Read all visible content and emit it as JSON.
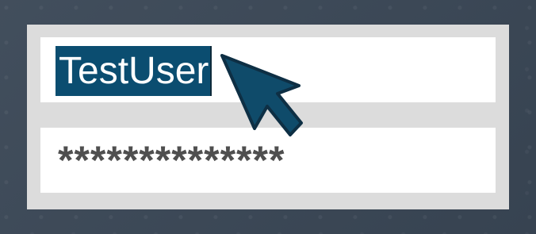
{
  "login": {
    "username": "TestUser",
    "password_masked": "**************"
  },
  "cursor": {
    "icon": "arrow-cursor-icon"
  },
  "colors": {
    "background": "#3a4756",
    "panel": "#dcdcdc",
    "field": "#ffffff",
    "selection": "#0b4d70",
    "password_text": "#4f4f4f",
    "cursor": "#0f4b6a"
  }
}
